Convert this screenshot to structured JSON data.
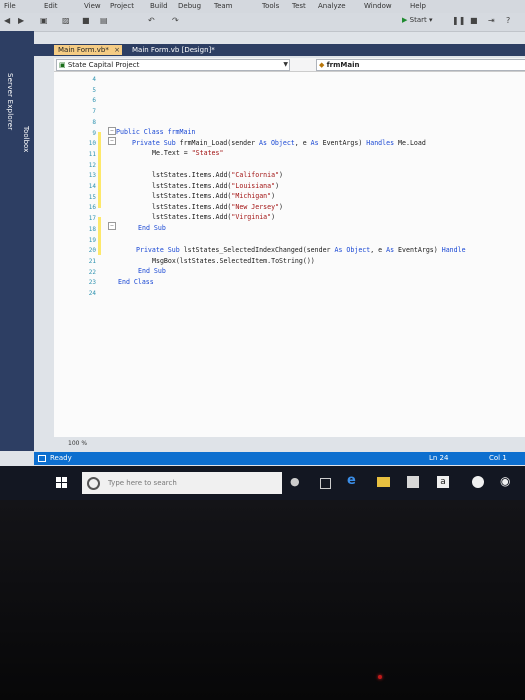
{
  "menu": [
    "File",
    "Edit",
    "View",
    "Project",
    "Build",
    "Debug",
    "Team",
    "Tools",
    "Test",
    "Analyze",
    "Window",
    "Help"
  ],
  "toolbar": {
    "start_label": "Start"
  },
  "rail": {
    "server_explorer": "Server Explorer",
    "toolbox": "Toolbox"
  },
  "tabs": [
    {
      "label": "Main Form.vb*",
      "active": true
    },
    {
      "label": "Main Form.vb [Design]*",
      "active": false
    }
  ],
  "nav": {
    "left": "State Capital Project",
    "right": "frmMain"
  },
  "editor": {
    "line_numbers": [
      "4",
      "5",
      "6",
      "7",
      "8",
      "9",
      "10",
      "11",
      "12",
      "13",
      "14",
      "15",
      "16",
      "17",
      "18",
      "19",
      "20",
      "21",
      "22",
      "23",
      "24"
    ],
    "zoom": "100 %"
  },
  "code": {
    "l9": "Public Class frmMain",
    "l10_kw1": "Private Sub",
    "l10_mid": " frmMain_Load(sender ",
    "l10_kw2": "As Object",
    "l10_mid2": ", e ",
    "l10_kw3": "As",
    "l10_mid3": " EventArgs) ",
    "l10_kw4": "Handles",
    "l10_end": " Me.Load",
    "l11_a": "Me.Text = ",
    "l11_str": "\"States\"",
    "l13_a": "lstStates.Items.Add(",
    "l13_str": "\"California\"",
    "l14_str": "\"Louisiana\"",
    "l15_str": "\"Michigan\"",
    "l16_str": "\"New Jersey\"",
    "l17_str": "\"Virginia\"",
    "close": ")",
    "l18": "End Sub",
    "l20_kw1": "Private Sub",
    "l20_mid": " lstStates_SelectedIndexChanged(sender ",
    "l20_kw2": "As Object",
    "l20_mid2": ", e ",
    "l20_kw3": "As",
    "l20_mid3": " EventArgs) ",
    "l20_kw4": "Handle",
    "l21": "MsgBox(lstStates.SelectedItem.ToString())",
    "l22": "End Sub",
    "l23": "End Class"
  },
  "status": {
    "ready": "Ready",
    "ln": "Ln 24",
    "col": "Col 1"
  },
  "taskbar": {
    "search_placeholder": "Type here to search"
  },
  "colors": {
    "accent": "#0d6fcf",
    "rail": "#2d3e63",
    "tab_active": "#f5cc84",
    "keyword": "#1a48d4",
    "string": "#a31515"
  }
}
